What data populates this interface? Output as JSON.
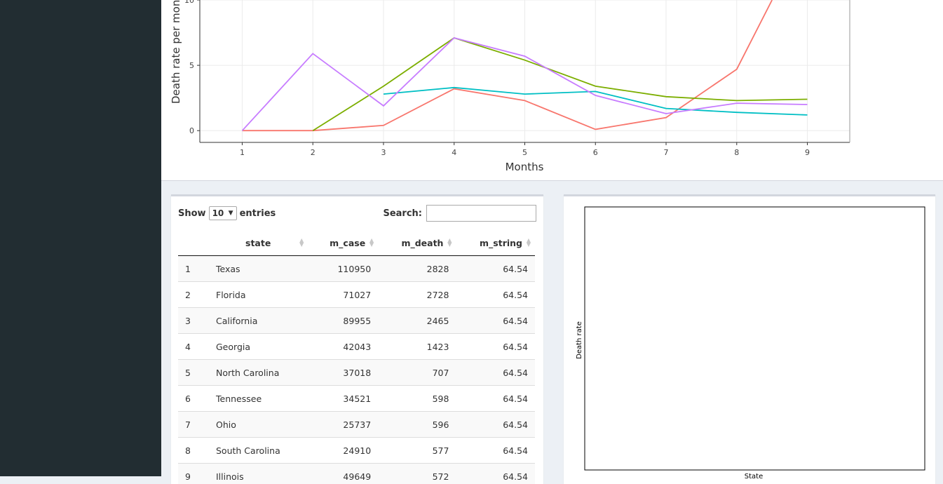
{
  "chart_data": {
    "type": "line",
    "xlabel": "Months",
    "ylabel": "Death rate per mon",
    "x_ticks": [
      1,
      2,
      3,
      4,
      5,
      6,
      7,
      8,
      9
    ],
    "y_ticks": [
      0,
      5
    ],
    "y_tick_top_partial": "10",
    "ylim": [
      -0.9,
      10
    ],
    "xlim": [
      0.4,
      9.6
    ],
    "grid": true,
    "series": [
      {
        "color": "#f8766d",
        "points": [
          [
            1,
            0
          ],
          [
            2,
            0
          ],
          [
            3,
            0.4
          ],
          [
            4,
            3.2
          ],
          [
            5,
            2.3
          ],
          [
            6,
            0.1
          ],
          [
            7,
            1.0
          ],
          [
            8,
            4.7
          ],
          [
            8.5,
            10
          ]
        ]
      },
      {
        "color": "#7cae00",
        "points": [
          [
            2,
            0
          ],
          [
            3,
            3.4
          ],
          [
            4,
            7.1
          ],
          [
            5,
            5.4
          ],
          [
            6,
            3.4
          ],
          [
            7,
            2.6
          ],
          [
            8,
            2.3
          ],
          [
            9,
            2.4
          ]
        ]
      },
      {
        "color": "#00bfc4",
        "points": [
          [
            3,
            2.8
          ],
          [
            4,
            3.3
          ],
          [
            5,
            2.8
          ],
          [
            6,
            3.0
          ],
          [
            7,
            1.7
          ],
          [
            8,
            1.4
          ],
          [
            9,
            1.2
          ]
        ]
      },
      {
        "color": "#c77cff",
        "points": [
          [
            1,
            0
          ],
          [
            2,
            5.9
          ],
          [
            3,
            1.9
          ],
          [
            4,
            7.1
          ],
          [
            5,
            5.7
          ],
          [
            6,
            2.7
          ],
          [
            7,
            1.3
          ],
          [
            8,
            2.1
          ],
          [
            9,
            2.0
          ]
        ]
      }
    ]
  },
  "table": {
    "show_label": "Show",
    "entries_label": "entries",
    "length_value": "10",
    "search_label": "Search:",
    "search_value": "",
    "columns": [
      "",
      "state",
      "m_case",
      "m_death",
      "m_string"
    ],
    "rows": [
      [
        "1",
        "Texas",
        "110950",
        "2828",
        "64.54"
      ],
      [
        "2",
        "Florida",
        "71027",
        "2728",
        "64.54"
      ],
      [
        "3",
        "California",
        "89955",
        "2465",
        "64.54"
      ],
      [
        "4",
        "Georgia",
        "42043",
        "1423",
        "64.54"
      ],
      [
        "5",
        "North Carolina",
        "37018",
        "707",
        "64.54"
      ],
      [
        "6",
        "Tennessee",
        "34521",
        "598",
        "64.54"
      ],
      [
        "7",
        "Ohio",
        "25737",
        "596",
        "64.54"
      ],
      [
        "8",
        "South Carolina",
        "24910",
        "577",
        "64.54"
      ],
      [
        "9",
        "Illinois",
        "49649",
        "572",
        "64.54"
      ]
    ]
  },
  "right_plot": {
    "ylabel": "Death rate",
    "xlabel": "State"
  },
  "colors": {
    "sidebar": "#222d32",
    "background": "#ecf0f5"
  }
}
